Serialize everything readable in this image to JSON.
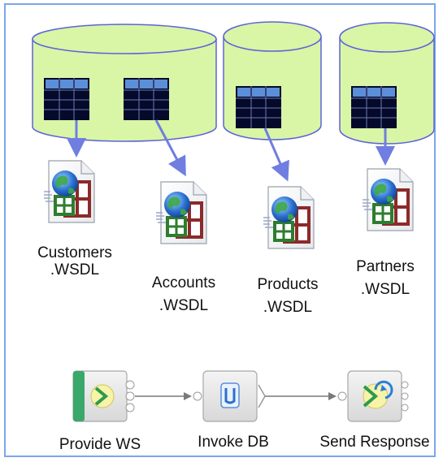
{
  "wsdl_files": [
    {
      "name_line1": "Customers",
      "name_line2": ".WSDL"
    },
    {
      "name_line1": "Accounts",
      "name_line2": ".WSDL"
    },
    {
      "name_line1": "Products",
      "name_line2": ".WSDL"
    },
    {
      "name_line1": "Partners",
      "name_line2": ".WSDL"
    }
  ],
  "flow_steps": [
    {
      "label": "Provide WS",
      "icon": "provide-ws-icon"
    },
    {
      "label": "Invoke DB",
      "icon": "invoke-db-icon"
    },
    {
      "label": "Send Response",
      "icon": "send-response-icon"
    }
  ],
  "colors": {
    "cylinder_fill": "#d9f5a6",
    "cylinder_stroke": "#5d63d8",
    "arrow": "#6f7ee0",
    "table_dark": "#050a2a",
    "table_header": "#5b8fd8",
    "frame": "#7aa6ec"
  }
}
